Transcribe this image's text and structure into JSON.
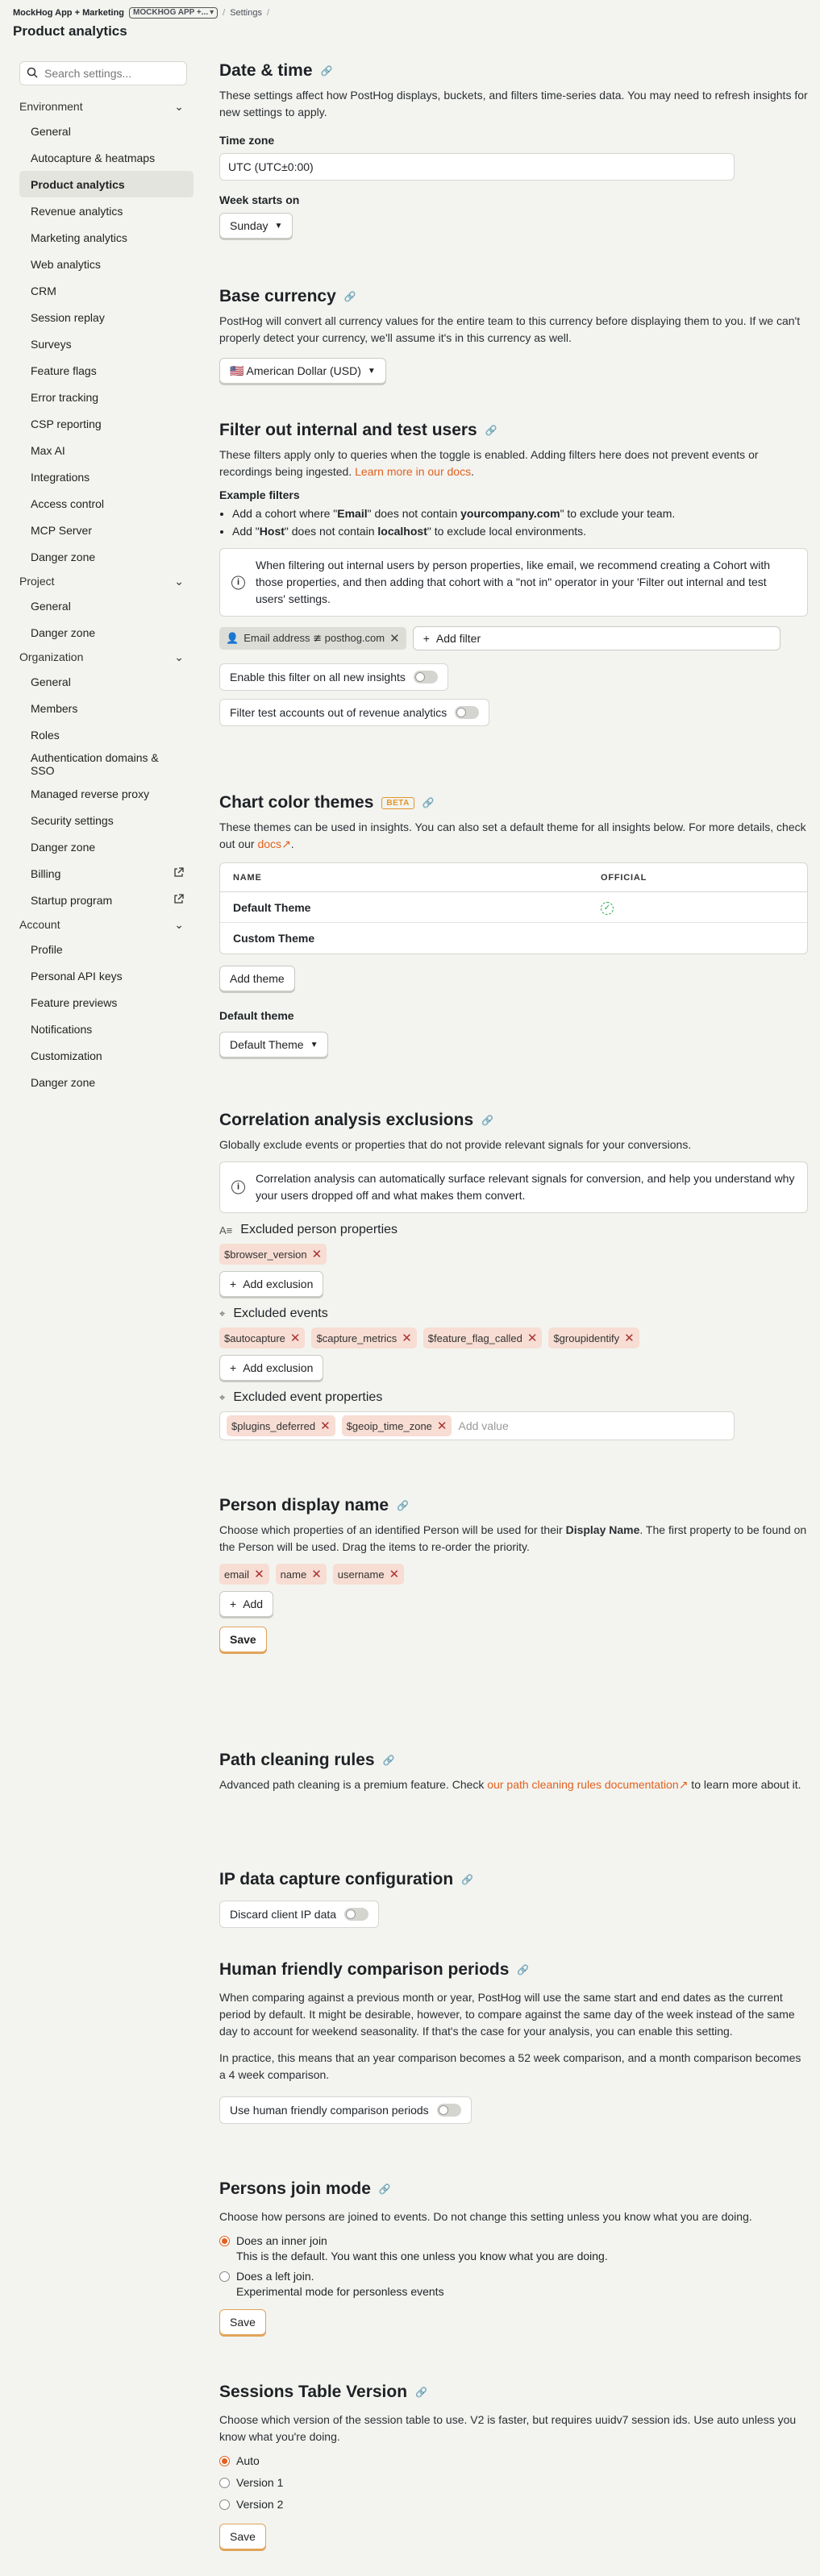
{
  "header": {
    "org": "MockHog App + Marketing",
    "project_button": "MOCKHOG APP +...",
    "section": "Settings",
    "title": "Product analytics"
  },
  "sidebar": {
    "search_placeholder": "Search settings...",
    "groups": [
      {
        "label": "Environment",
        "items": [
          "General",
          "Autocapture & heatmaps",
          "Product analytics",
          "Revenue analytics",
          "Marketing analytics",
          "Web analytics",
          "CRM",
          "Session replay",
          "Surveys",
          "Feature flags",
          "Error tracking",
          "CSP reporting",
          "Max AI",
          "Integrations",
          "Access control",
          "MCP Server",
          "Danger zone"
        ]
      },
      {
        "label": "Project",
        "items": [
          "General",
          "Danger zone"
        ]
      },
      {
        "label": "Organization",
        "items": [
          "General",
          "Members",
          "Roles",
          "Authentication domains & SSO",
          "Managed reverse proxy",
          "Security settings",
          "Danger zone",
          "Billing",
          "Startup program"
        ]
      },
      {
        "label": "Account",
        "items": [
          "Profile",
          "Personal API keys",
          "Feature previews",
          "Notifications",
          "Customization",
          "Danger zone"
        ]
      }
    ]
  },
  "datetime": {
    "title": "Date & time",
    "desc": "These settings affect how PostHog displays, buckets, and filters time-series data. You may need to refresh insights for new settings to apply.",
    "tz_label": "Time zone",
    "tz_value": "UTC (UTC±0:00)",
    "week_label": "Week starts on",
    "week_value": "Sunday"
  },
  "currency": {
    "title": "Base currency",
    "desc": "PostHog will convert all currency values for the entire team to this currency before displaying them to you. If we can't properly detect your currency, we'll assume it's in this currency as well.",
    "value": "🇺🇸 American Dollar (USD)"
  },
  "filters": {
    "title": "Filter out internal and test users",
    "desc": "These filters apply only to queries when the toggle is enabled. Adding filters here does not prevent events or recordings being ingested.",
    "desc_link": "Learn more in our docs",
    "examples_label": "Example filters",
    "ex1_a": "Add a cohort where \"",
    "ex1_b": "Email",
    "ex1_c": "\" does not contain ",
    "ex1_d": "yourcompany.com",
    "ex1_e": "\" to exclude your team.",
    "ex2_a": "Add \"",
    "ex2_b": "Host",
    "ex2_c": "\" does not contain ",
    "ex2_d": "localhost",
    "ex2_e": "\" to exclude local environments.",
    "note": "When filtering out internal users by person properties, like email, we recommend creating a Cohort with those properties, and then adding that cohort with a \"not in\" operator in your 'Filter out internal and test users' settings.",
    "chip": "Email address ≇ posthog.com",
    "add_filter": "Add filter",
    "toggle1": "Enable this filter on all new insights",
    "toggle2": "Filter test accounts out of revenue analytics"
  },
  "themes": {
    "title": "Chart color themes",
    "badge": "BETA",
    "desc_a": "These themes can be used in insights. You can also set a default theme for all insights below. For more details, check out our ",
    "desc_link": "docs",
    "col_name": "NAME",
    "col_official": "OFFICIAL",
    "rows": [
      "Default Theme",
      "Custom Theme"
    ],
    "add": "Add theme",
    "default_label": "Default theme",
    "default_value": "Default Theme"
  },
  "correlation": {
    "title": "Correlation analysis exclusions",
    "desc": "Globally exclude events or properties that do not provide relevant signals for your conversions.",
    "note": "Correlation analysis can automatically surface relevant signals for conversion, and help you understand why your users dropped off and what makes them convert.",
    "person_label": "Excluded person properties",
    "person_chips": [
      "$browser_version"
    ],
    "add_exclusion": "Add exclusion",
    "events_label": "Excluded events",
    "event_chips": [
      "$autocapture",
      "$capture_metrics",
      "$feature_flag_called",
      "$groupidentify"
    ],
    "event_props_label": "Excluded event properties",
    "event_prop_chips": [
      "$plugins_deferred",
      "$geoip_time_zone"
    ],
    "add_value": "Add value"
  },
  "display_name": {
    "title": "Person display name",
    "desc_a": "Choose which properties of an identified Person will be used for their ",
    "desc_b": "Display Name",
    "desc_c": ". The first property to be found on the Person will be used. Drag the items to re-order the priority.",
    "chips": [
      "email",
      "name",
      "username"
    ],
    "add": "Add",
    "save": "Save"
  },
  "path": {
    "title": "Path cleaning rules",
    "desc_a": "Advanced path cleaning is a premium feature. Check ",
    "desc_link": "our path cleaning rules documentation",
    "desc_b": " to learn more about it."
  },
  "ip": {
    "title": "IP data capture configuration",
    "toggle": "Discard client IP data"
  },
  "comparison": {
    "title": "Human friendly comparison periods",
    "p1": "When comparing against a previous month or year, PostHog will use the same start and end dates as the current period by default. It might be desirable, however, to compare against the same day of the week instead of the same day to account for weekend seasonality. If that's the case for your analysis, you can enable this setting.",
    "p2": "In practice, this means that an year comparison becomes a 52 week comparison, and a month comparison becomes a 4 week comparison.",
    "toggle": "Use human friendly comparison periods"
  },
  "join": {
    "title": "Persons join mode",
    "desc": "Choose how persons are joined to events. Do not change this setting unless you know what you are doing.",
    "opt1_title": "Does an inner join",
    "opt1_desc": "This is the default. You want this one unless you know what you are doing.",
    "opt2_title": "Does a left join.",
    "opt2_desc": "Experimental mode for personless events",
    "save": "Save"
  },
  "sessions": {
    "title": "Sessions Table Version",
    "desc": "Choose which version of the session table to use. V2 is faster, but requires uuidv7 session ids. Use auto unless you know what you're doing.",
    "options": [
      "Auto",
      "Version 1",
      "Version 2"
    ],
    "save": "Save"
  }
}
